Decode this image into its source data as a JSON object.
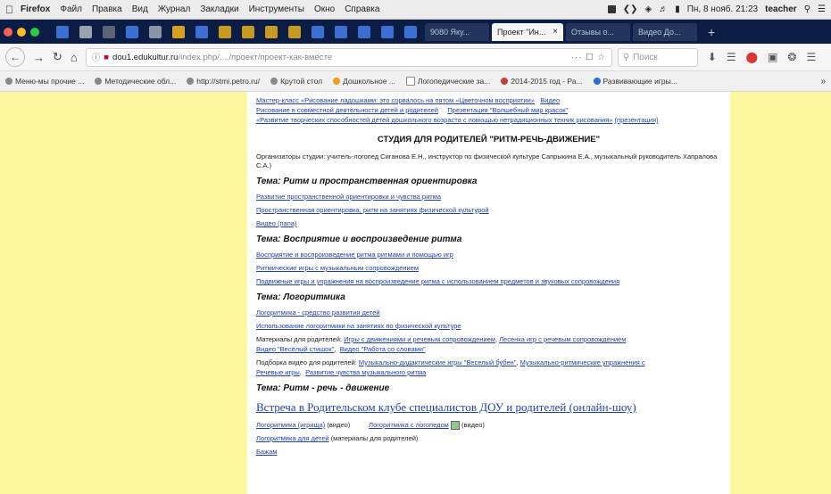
{
  "menubar": {
    "app": "Firefox",
    "items": [
      "Файл",
      "Правка",
      "Вид",
      "Журнал",
      "Закладки",
      "Инструменты",
      "Окно",
      "Справка"
    ],
    "status_right": [
      "Пн, 8 нояб. 21:23",
      "teacher"
    ]
  },
  "tabs": {
    "dark1": "9080 Яку...",
    "active": "Проект \"Ин...",
    "dark2": "Отзывы о...",
    "dark3": "Видео До..."
  },
  "nav": {
    "url_host": "dou1.edukultur.ru",
    "url_path": "/index.php/..../проект/проект-как-вместе",
    "url_actions": "··· ☐ ☆",
    "search_placeholder": "Поиск"
  },
  "bookmarks": [
    "Меню-мы прочие ...",
    "Методические обл...",
    "http://stmi.petro.ru/",
    "Крутой стол",
    "Дошкольное ...",
    "Логопедические за...",
    "2014-2015 год - Ра...",
    "Развивающие игры..."
  ],
  "content": {
    "top_links": [
      "Мастер-класс «Рисование ладошками: это сорвалось на пятом «Цветочном восприятии»",
      "Рисование в совместной деятельности детей и родителей",
      "«Развитие творческих способностей детей дошкольного возраста с помощью нетрадиционных техник рисования»"
    ],
    "top_links_extra": [
      "Видео",
      "Презентация \"Волшебный мир красок\""
    ],
    "top_links_cont": "(презентация)",
    "studio_title": "СТУДИЯ ДЛЯ РОДИТЕЛЕЙ \"РИТМ-РЕЧЬ-ДВИЖЕНИЕ\"",
    "organizers": "Организаторы студии: учитель-логопед Сиганова Е.Н., инструктор по физической культуре Сапрыкина Е.А., музыкальный руководитель Хапралова С.А.)",
    "theme1": "Тема: Ритм и пространственная ориентировка",
    "theme1_links": [
      "Развитие пространственной ориентировки и чувства ритма",
      "Пространственная ориентировка, ритм на занятиях физической культурой",
      "Видео (папа)"
    ],
    "theme2": "Тема: Восприятие и воспроизведение ритма",
    "theme2_links": [
      "Восприятие и воспроизведение ритма ритмами и помощью игр",
      "Ритмические игры с музыкальным сопровождением",
      "Подвижные игры и упражнения на воспроизведение ритма с использованием предметов и звуковых сопровождения"
    ],
    "theme3": "Тема: Логоритмика",
    "theme3_links": [
      "Логоритмика - средство развития детей",
      "Использование логоритмики на занятиях по физической культуре"
    ],
    "materials_label": "Материалы для родителей:",
    "materials_links": [
      "Игры с движениями и речевым сопровождением",
      "Лесенка игр с речевым сопровождением"
    ],
    "materials_links2": [
      "Видео \"Весёлый стишок\"",
      "Видео \"Работа со словами\""
    ],
    "videos_label": "Подборка видео для родителей:",
    "videos_links": [
      "Музыкально-дидактические игры \"Веселый бубен\"",
      "Музыкально-ритмические упражнения с"
    ],
    "videos_links2": [
      "Речевые игры",
      "Развитие чувства музыкального ритма"
    ],
    "theme4": "Тема: Ритм - речь - движение",
    "big_link": "Встреча в Родительском клубе специалистов ДОУ и родителей (онлайн-шоу)",
    "bottom_rows": [
      {
        "link": "Логоритмика (игрища)",
        "note": "(видео)"
      },
      {
        "link": "Логоритмика с логопедом",
        "note": "(видео)"
      }
    ],
    "bottom_link": "Логоритмика для детей",
    "bottom_link_note": "(материалы для родителей)",
    "last_link": "Бажам"
  },
  "colors": {
    "page_bg": "#fdf8a0",
    "link": "#1f3fb0",
    "tab_bg": "#0b1d44"
  }
}
